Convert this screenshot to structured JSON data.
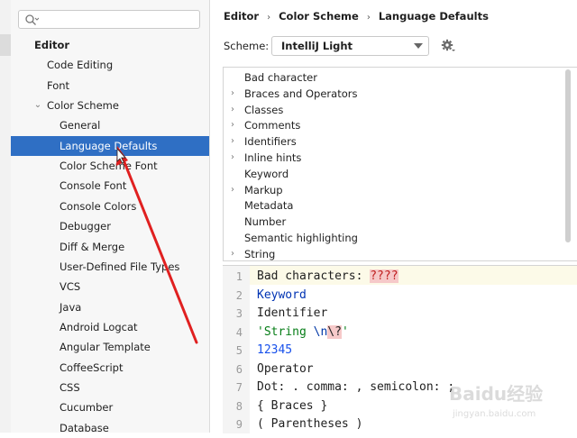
{
  "search": {
    "placeholder": "",
    "value": ""
  },
  "tree": {
    "items": [
      {
        "label": "Editor",
        "level": 0,
        "bold": true,
        "chevron": ""
      },
      {
        "label": "Code Editing",
        "level": 1,
        "chevron": ""
      },
      {
        "label": "Font",
        "level": 1,
        "chevron": ""
      },
      {
        "label": "Color Scheme",
        "level": 1,
        "chevron": "chevron-down"
      },
      {
        "label": "General",
        "level": 2,
        "chevron": ""
      },
      {
        "label": "Language Defaults",
        "level": 2,
        "selected": true,
        "chevron": ""
      },
      {
        "label": "Color Scheme Font",
        "level": 2,
        "chevron": ""
      },
      {
        "label": "Console Font",
        "level": 2,
        "chevron": ""
      },
      {
        "label": "Console Colors",
        "level": 2,
        "chevron": ""
      },
      {
        "label": "Debugger",
        "level": 2,
        "chevron": ""
      },
      {
        "label": "Diff & Merge",
        "level": 2,
        "chevron": ""
      },
      {
        "label": "User-Defined File Types",
        "level": 2,
        "chevron": ""
      },
      {
        "label": "VCS",
        "level": 2,
        "chevron": ""
      },
      {
        "label": "Java",
        "level": 2,
        "chevron": ""
      },
      {
        "label": "Android Logcat",
        "level": 2,
        "chevron": ""
      },
      {
        "label": "Angular Template",
        "level": 2,
        "chevron": ""
      },
      {
        "label": "CoffeeScript",
        "level": 2,
        "chevron": ""
      },
      {
        "label": "CSS",
        "level": 2,
        "chevron": ""
      },
      {
        "label": "Cucumber",
        "level": 2,
        "chevron": ""
      },
      {
        "label": "Database",
        "level": 2,
        "chevron": ""
      }
    ]
  },
  "breadcrumb": [
    "Editor",
    "Color Scheme",
    "Language Defaults"
  ],
  "scheme": {
    "label": "Scheme:",
    "value": "IntelliJ Light"
  },
  "categories": [
    {
      "label": "Bad character",
      "expandable": false
    },
    {
      "label": "Braces and Operators",
      "expandable": true
    },
    {
      "label": "Classes",
      "expandable": true
    },
    {
      "label": "Comments",
      "expandable": true
    },
    {
      "label": "Identifiers",
      "expandable": true
    },
    {
      "label": "Inline hints",
      "expandable": true
    },
    {
      "label": "Keyword",
      "expandable": false
    },
    {
      "label": "Markup",
      "expandable": true
    },
    {
      "label": "Metadata",
      "expandable": false
    },
    {
      "label": "Number",
      "expandable": false
    },
    {
      "label": "Semantic highlighting",
      "expandable": false
    },
    {
      "label": "String",
      "expandable": true
    }
  ],
  "preview": {
    "line_numbers": [
      "1",
      "2",
      "3",
      "4",
      "5",
      "6",
      "7",
      "8",
      "9"
    ],
    "lines": [
      [
        {
          "t": "Bad characters: ",
          "c": ""
        },
        {
          "t": "????",
          "c": "bad"
        }
      ],
      [
        {
          "t": "Keyword",
          "c": "kw"
        }
      ],
      [
        {
          "t": "Identifier",
          "c": ""
        }
      ],
      [
        {
          "t": "'String ",
          "c": "str"
        },
        {
          "t": "\\n",
          "c": "esc"
        },
        {
          "t": "\\?",
          "c": "esc-bad"
        },
        {
          "t": "'",
          "c": "str"
        }
      ],
      [
        {
          "t": "12345",
          "c": "num"
        }
      ],
      [
        {
          "t": "Operator",
          "c": ""
        }
      ],
      [
        {
          "t": "Dot: . comma: , semicolon: ;",
          "c": ""
        }
      ],
      [
        {
          "t": "{ Braces }",
          "c": ""
        }
      ],
      [
        {
          "t": "( Parentheses )",
          "c": ""
        }
      ]
    ]
  },
  "watermark": {
    "text": "Baidu经验",
    "subtext": "jingyan.baidu.com"
  },
  "colors": {
    "selection": "#2f6fc4",
    "annotation_arrow": "#e02020",
    "bad_char_bg": "#f6c9c9"
  }
}
